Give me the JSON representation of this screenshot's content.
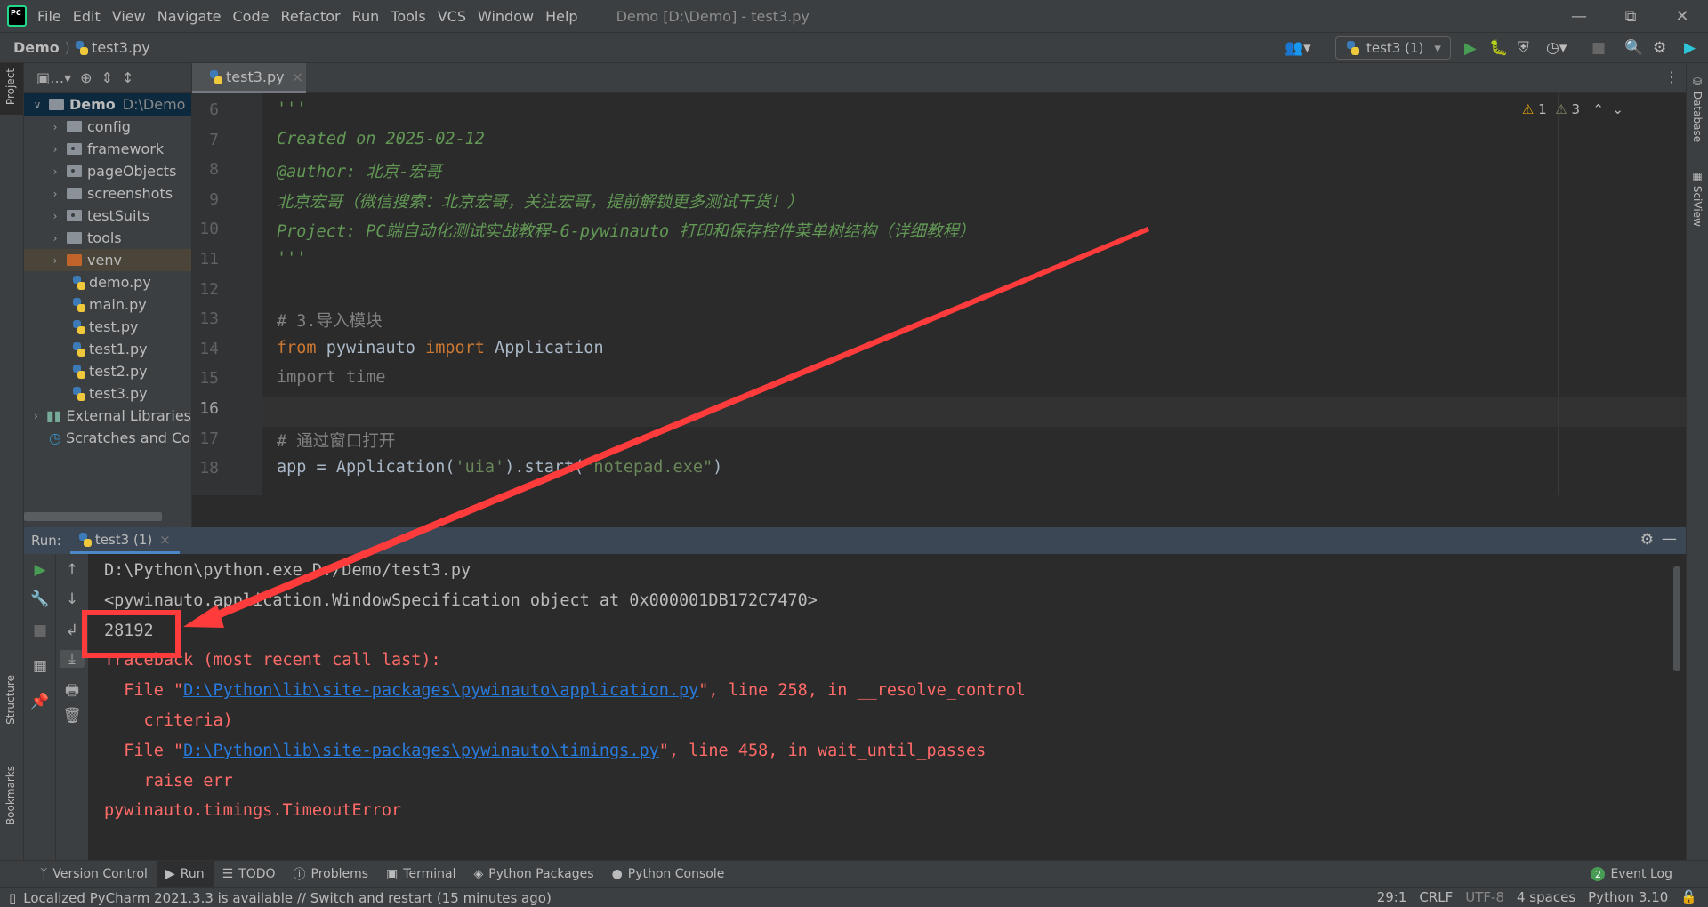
{
  "window": {
    "title": "Demo [D:\\Demo] - test3.py",
    "logo": "PC"
  },
  "menu": [
    "File",
    "Edit",
    "View",
    "Navigate",
    "Code",
    "Refactor",
    "Run",
    "Tools",
    "VCS",
    "Window",
    "Help"
  ],
  "breadcrumb": {
    "project": "Demo",
    "file": "test3.py"
  },
  "toolbar": {
    "run_config": "test3 (1)"
  },
  "left_strip": {
    "project": "Project",
    "structure": "Structure",
    "bookmarks": "Bookmarks"
  },
  "right_strip": {
    "database": "Database",
    "sciview": "SciView"
  },
  "project_tree": {
    "root": {
      "name": "Demo",
      "path": "D:\\Demo"
    },
    "items": [
      {
        "label": "config",
        "type": "folder"
      },
      {
        "label": "framework",
        "type": "package"
      },
      {
        "label": "pageObjects",
        "type": "package"
      },
      {
        "label": "screenshots",
        "type": "folder"
      },
      {
        "label": "testSuits",
        "type": "package"
      },
      {
        "label": "tools",
        "type": "folder"
      },
      {
        "label": "venv",
        "type": "venv"
      },
      {
        "label": "demo.py",
        "type": "py"
      },
      {
        "label": "main.py",
        "type": "py"
      },
      {
        "label": "test.py",
        "type": "py"
      },
      {
        "label": "test1.py",
        "type": "py"
      },
      {
        "label": "test2.py",
        "type": "py"
      },
      {
        "label": "test3.py",
        "type": "py"
      }
    ],
    "external": "External Libraries",
    "scratches": "Scratches and Consoles"
  },
  "editor": {
    "tab": "test3.py",
    "warnings": "1",
    "weak_warnings": "3",
    "line_numbers": [
      "6",
      "7",
      "8",
      "9",
      "10",
      "11",
      "12",
      "13",
      "14",
      "15",
      "16",
      "17",
      "18"
    ],
    "lines": {
      "l6": "'''",
      "l7": "Created on 2025-02-12",
      "l8": "@author: 北京-宏哥",
      "l9": "北京宏哥（微信搜索：北京宏哥，关注宏哥，提前解锁更多测试干货！）",
      "l10": "Project: PC端自动化测试实战教程-6-pywinauto 打印和保存控件菜单树结构（详细教程）",
      "l11": "'''",
      "l13": "# 3.导入模块",
      "l14a": "from",
      "l14b": " pywinauto ",
      "l14c": "import",
      "l14d": " Application",
      "l15": "import time",
      "l17": "# 通过窗口打开",
      "l18a": "app = Application(",
      "l18b": "'uia'",
      "l18c": ").start(",
      "l18d": "\"notepad.exe\"",
      "l18e": ")"
    }
  },
  "run_panel": {
    "label": "Run:",
    "tab": "test3 (1)",
    "output": {
      "o1": "D:\\Python\\python.exe D:/Demo/test3.py",
      "o2": "<pywinauto.application.WindowSpecification object at 0x000001DB172C7470>",
      "o3": "28192",
      "o4": "Traceback (most recent call last):",
      "o5a": "  File \"",
      "o5b": "D:\\Python\\lib\\site-packages\\pywinauto\\application.py",
      "o5c": "\", line 258, in __resolve_control",
      "o6": "    criteria)",
      "o7a": "  File \"",
      "o7b": "D:\\Python\\lib\\site-packages\\pywinauto\\timings.py",
      "o7c": "\", line 458, in wait_until_passes",
      "o8": "    raise err",
      "o9": "pywinauto.timings.TimeoutError"
    }
  },
  "bottom_tabs": [
    "Version Control",
    "Run",
    "TODO",
    "Problems",
    "Terminal",
    "Python Packages",
    "Python Console"
  ],
  "event_log": {
    "count": "2",
    "label": "Event Log"
  },
  "status": {
    "message": "Localized PyCharm 2021.3.3 is available // Switch and restart (15 minutes ago)",
    "position": "29:1",
    "line_sep": "CRLF",
    "encoding": "UTF-8",
    "indent": "4 spaces",
    "interpreter": "Python 3.10"
  },
  "annotation_color": "#ff3b3b"
}
